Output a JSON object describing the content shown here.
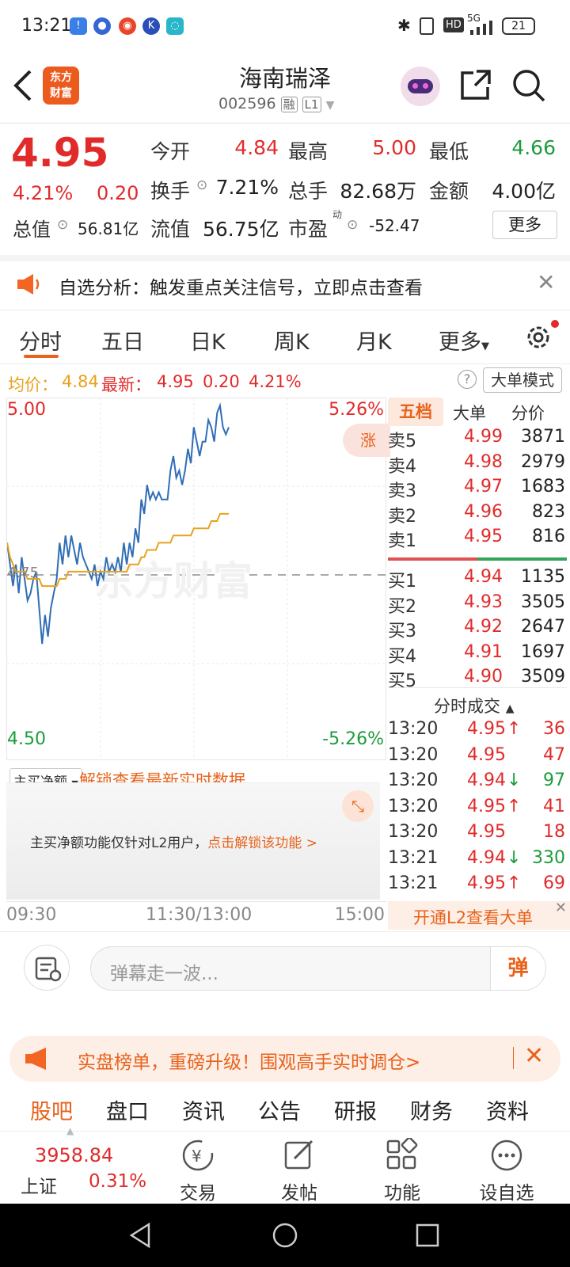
{
  "status_bar": {
    "time": "13:21",
    "battery": "21",
    "network": "5G"
  },
  "header": {
    "logo_text_1": "东方",
    "logo_text_2": "财富",
    "title": "海南瑞泽",
    "code": "002596",
    "badge_rong": "融",
    "badge_level": "L1"
  },
  "quote": {
    "price": "4.95",
    "change_pct": "4.21%",
    "change": "0.20",
    "open_label": "今开",
    "open": "4.84",
    "high_label": "最高",
    "high": "5.00",
    "low_label": "最低",
    "low": "4.66",
    "turnover_label": "换手",
    "turnover": "7.21%",
    "volume_label": "总手",
    "volume": "82.68万",
    "amount_label": "金额",
    "amount": "4.00亿",
    "mktcap_label": "总值",
    "mktcap": "56.81亿",
    "float_label": "流值",
    "float_cap": "56.75亿",
    "pe_label": "市盈",
    "pe_sup": "动",
    "pe": "-52.47",
    "more_button": "更多"
  },
  "notice": {
    "text": "自选分析：触发重点关注信号，立即点击查看"
  },
  "tabs": [
    "分时",
    "五日",
    "日K",
    "周K",
    "月K",
    "更多"
  ],
  "avg_bar": {
    "avg_label": "均价：",
    "avg": "4.84",
    "latest_label": "最新：",
    "latest": "4.95",
    "change": "0.20",
    "change_pct": "4.21%",
    "mode_button": "大单模式"
  },
  "chart": {
    "y_top": "5.00",
    "y_mid": "4.75",
    "y_bottom": "4.50",
    "pct_top": "5.26%",
    "pct_bottom": "-5.26%",
    "zhang_label": "涨",
    "watermark": "东方财富",
    "x_labels": [
      "09:30",
      "11:30/13:00",
      "15:00"
    ],
    "colors": {
      "price": "#2f6eb5",
      "avg": "#e8a21c"
    }
  },
  "chart_data": {
    "type": "line",
    "ylim": [
      4.5,
      5.0
    ],
    "prev_close": 4.75,
    "series": [
      {
        "name": "",
        "values": [
          4.8,
          4.77,
          4.74,
          4.77,
          4.73,
          4.78,
          4.75,
          4.72,
          4.73,
          4.75,
          4.76,
          4.71,
          4.66,
          4.7,
          4.67,
          4.71,
          4.73,
          4.75,
          4.8,
          4.77,
          4.81,
          4.78,
          4.81,
          4.79,
          4.77,
          4.8,
          4.78,
          4.77,
          4.76,
          4.75,
          4.77,
          4.74,
          4.76,
          4.75,
          4.78,
          4.76,
          4.77,
          4.76,
          4.78,
          4.76,
          4.8,
          4.77,
          4.8,
          4.78,
          4.82,
          4.8,
          4.86,
          4.84,
          4.88,
          4.86,
          4.87,
          4.86,
          4.87,
          4.86,
          4.86,
          4.86,
          4.9,
          4.92,
          4.89,
          4.9,
          4.88,
          4.9,
          4.93,
          4.91,
          4.96,
          4.94,
          4.92,
          4.94,
          4.94,
          4.97,
          4.96,
          4.94,
          4.98,
          4.99,
          4.96,
          4.95,
          4.96
        ]
      },
      {
        "name": "",
        "values": [
          4.8,
          4.78,
          4.77,
          4.76,
          4.76,
          4.76,
          4.76,
          4.75,
          4.75,
          4.75,
          4.75,
          4.75,
          4.74,
          4.74,
          4.74,
          4.74,
          4.74,
          4.74,
          4.75,
          4.75,
          4.75,
          4.76,
          4.76,
          4.76,
          4.76,
          4.76,
          4.76,
          4.76,
          4.76,
          4.76,
          4.76,
          4.76,
          4.76,
          4.76,
          4.76,
          4.76,
          4.76,
          4.76,
          4.76,
          4.76,
          4.76,
          4.76,
          4.77,
          4.77,
          4.77,
          4.77,
          4.78,
          4.78,
          4.79,
          4.79,
          4.79,
          4.79,
          4.8,
          4.8,
          4.8,
          4.8,
          4.8,
          4.81,
          4.81,
          4.81,
          4.81,
          4.81,
          4.81,
          4.81,
          4.82,
          4.82,
          4.82,
          4.82,
          4.82,
          4.82,
          4.83,
          4.83,
          4.83,
          4.84,
          4.84,
          4.84,
          4.84
        ]
      }
    ]
  },
  "book": {
    "tabs": [
      "五档",
      "大单",
      "分价"
    ],
    "sells": [
      {
        "label": "卖5",
        "price": "4.99",
        "vol": "3871"
      },
      {
        "label": "卖4",
        "price": "4.98",
        "vol": "2979"
      },
      {
        "label": "卖3",
        "price": "4.97",
        "vol": "1683"
      },
      {
        "label": "卖2",
        "price": "4.96",
        "vol": "823"
      },
      {
        "label": "卖1",
        "price": "4.95",
        "vol": "816"
      }
    ],
    "buys": [
      {
        "label": "买1",
        "price": "4.94",
        "vol": "1135"
      },
      {
        "label": "买2",
        "price": "4.93",
        "vol": "3505"
      },
      {
        "label": "买3",
        "price": "4.92",
        "vol": "2647"
      },
      {
        "label": "买4",
        "price": "4.91",
        "vol": "1697"
      },
      {
        "label": "买5",
        "price": "4.90",
        "vol": "3509"
      }
    ],
    "ticks_title": "分时成交",
    "ticks": [
      {
        "time": "13:20",
        "price": "4.95",
        "dir": "↑",
        "vol": "36",
        "color": "#e12b2b"
      },
      {
        "time": "13:20",
        "price": "4.95",
        "dir": "",
        "vol": "47",
        "color": "#e12b2b"
      },
      {
        "time": "13:20",
        "price": "4.94",
        "dir": "↓",
        "vol": "97",
        "color": "#1c9c3c"
      },
      {
        "time": "13:20",
        "price": "4.95",
        "dir": "↑",
        "vol": "41",
        "color": "#e12b2b"
      },
      {
        "time": "13:20",
        "price": "4.95",
        "dir": "",
        "vol": "18",
        "color": "#e12b2b"
      },
      {
        "time": "13:21",
        "price": "4.94",
        "dir": "↓",
        "vol": "330",
        "color": "#1c9c3c"
      },
      {
        "time": "13:21",
        "price": "4.95",
        "dir": "↑",
        "vol": "69",
        "color": "#e12b2b"
      }
    ],
    "l2_banner": "开通L2查看大单"
  },
  "netbuy": {
    "select": "主买净额",
    "unlock_link": "解锁查看最新实时数据",
    "info": "主买净额功能仅针对L2用户，",
    "info_link": "点击解锁该功能 >"
  },
  "comment": {
    "placeholder": "弹幕走一波...",
    "send": "弹"
  },
  "promo": {
    "text": "实盘榜单，重磅升级！围观高手实时调仓>"
  },
  "subtabs": [
    "股吧",
    "盘口",
    "资讯",
    "公告",
    "研报",
    "财务",
    "资料"
  ],
  "bottom_nav": {
    "index_value": "3958.84",
    "index_name": "上证",
    "index_pct": "0.31%",
    "items": [
      "交易",
      "发帖",
      "功能",
      "设自选"
    ]
  }
}
